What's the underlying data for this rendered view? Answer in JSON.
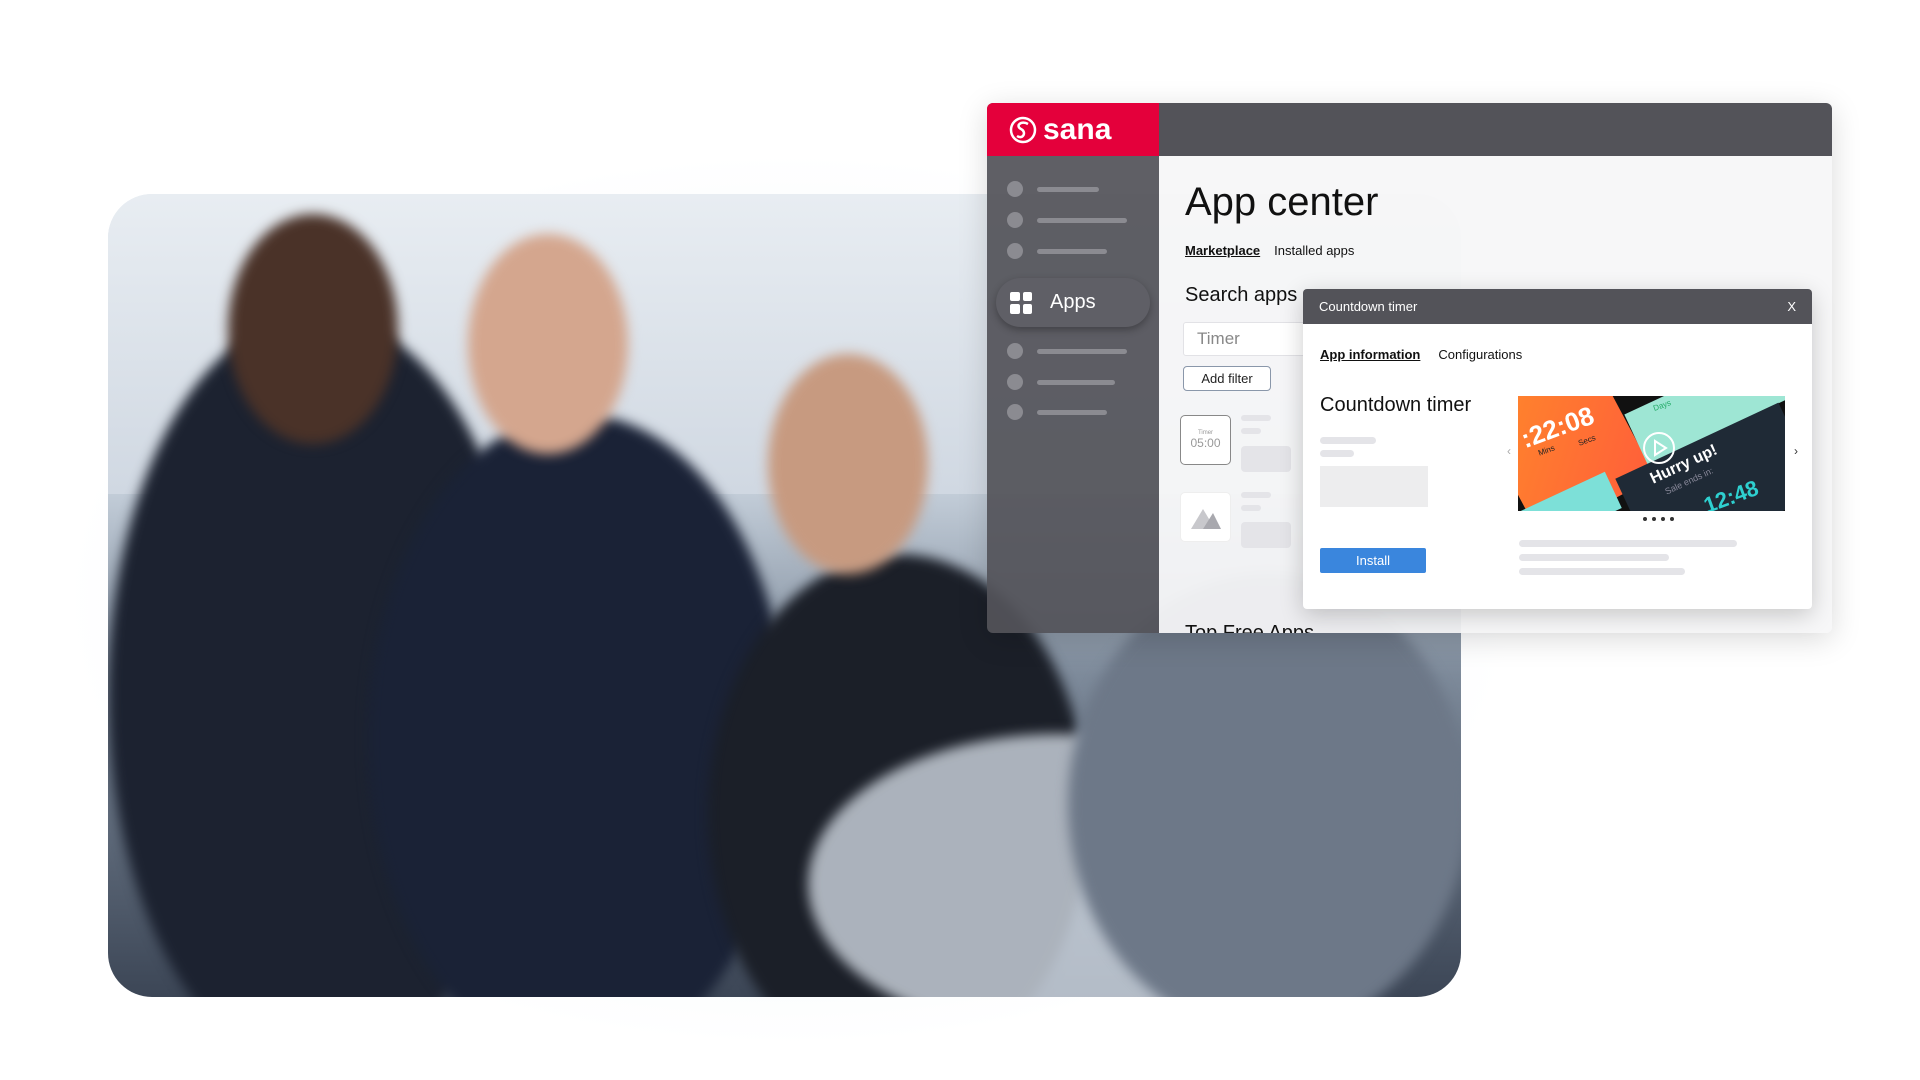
{
  "brand": {
    "name": "sana",
    "color": "#e4003b"
  },
  "sidebar": {
    "items": [
      {
        "label": "Apps",
        "icon": "apps-grid-icon",
        "active": true
      }
    ]
  },
  "main": {
    "title": "App center",
    "tabs": [
      {
        "label": "Marketplace",
        "active": true
      },
      {
        "label": "Installed apps",
        "active": false
      }
    ],
    "search_label": "Search apps",
    "search_value": "Timer",
    "add_filter": "Add filter",
    "timer_tile": {
      "caption": "Timer",
      "time": "05:00"
    },
    "section": "Top Free Apps"
  },
  "modal": {
    "title": "Countdown timer",
    "close": "X",
    "tabs": [
      {
        "label": "App information",
        "active": true
      },
      {
        "label": "Configurations",
        "active": false
      }
    ],
    "app_name": "Countdown timer",
    "install": "Install",
    "preview": {
      "time1": ":22:08",
      "mins": "Mins",
      "secs": "Secs",
      "days": "Days",
      "headline": "Hurry up!",
      "sub": "Sale ends in:",
      "time2": "12:48"
    },
    "accent": "#3a86dd"
  }
}
